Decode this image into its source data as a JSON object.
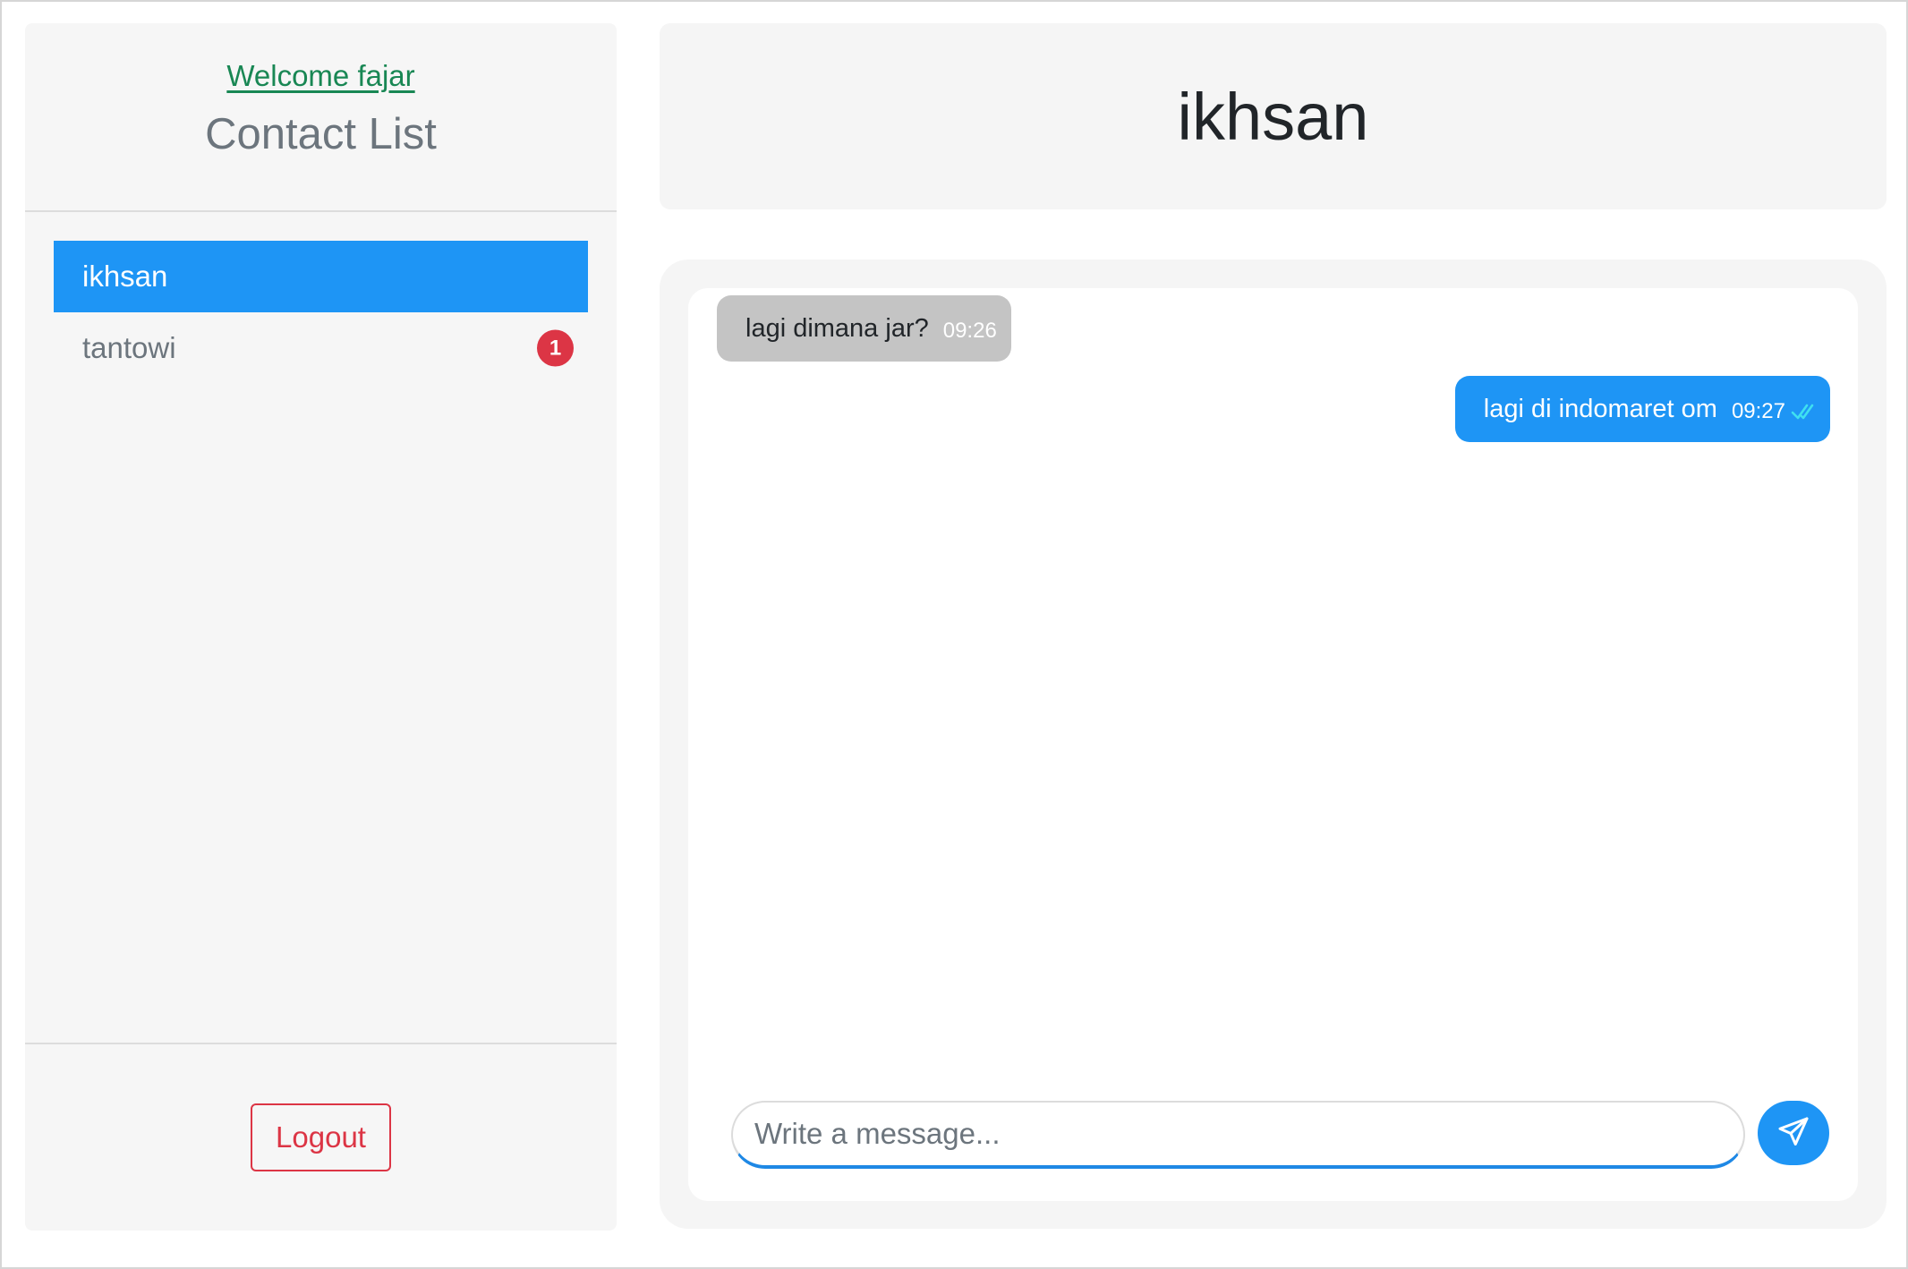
{
  "sidebar": {
    "welcome": "Welcome fajar",
    "title": "Contact List",
    "contacts": [
      {
        "name": "ikhsan",
        "active": true,
        "unread": ""
      },
      {
        "name": "tantowi",
        "active": false,
        "unread": "1"
      }
    ],
    "logout_label": "Logout"
  },
  "chat": {
    "title": "ikhsan",
    "messages": [
      {
        "direction": "incoming",
        "text": "lagi dimana jar?",
        "time": "09:26"
      },
      {
        "direction": "outgoing",
        "text": "lagi di indomaret om",
        "time": "09:27",
        "status_icon": "double-check-icon"
      }
    ],
    "composer": {
      "placeholder": "Write a message...",
      "value": "",
      "send_icon": "paper-plane-icon"
    }
  },
  "colors": {
    "accent": "#1e95f5",
    "welcome": "#198754",
    "danger": "#dc3545",
    "incoming_bubble": "#c4c4c4",
    "panel_bg": "#f5f5f5",
    "read_check": "#3fe0f0"
  }
}
